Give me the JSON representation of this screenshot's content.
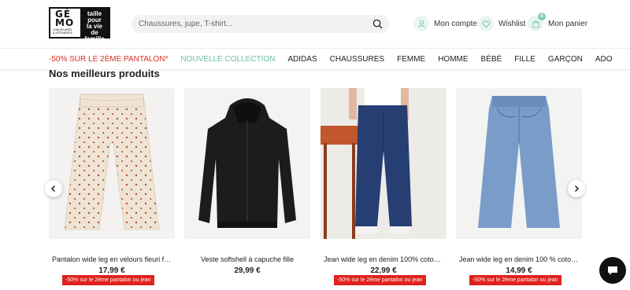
{
  "header": {
    "logo_letters": "GÉ\nMO",
    "logo_tagline": "taille\npour\nla vie\nde\nfamille",
    "logo_sub": "CHAUSSURES\n& VÊTEMENTS",
    "search_placeholder": "Chaussures, jupe, T-shirt...",
    "account_label": "Mon compte",
    "wishlist_label": "Wishlist",
    "cart_label": "Mon panier",
    "cart_count": "0"
  },
  "nav": [
    "-50% SUR LE 2ÈME PANTALON*",
    "NOUVELLE COLLECTION",
    "ADIDAS",
    "CHAUSSURES",
    "FEMME",
    "HOMME",
    "BÉBÉ",
    "FILLE",
    "GARÇON",
    "ADO"
  ],
  "section_title": "Nos meilleurs produits",
  "products": [
    {
      "name": "Pantalon wide leg en velours fleuri fill...",
      "price": "17,99 €",
      "badge": "-50% sur le 2ème pantalon ou jean"
    },
    {
      "name": "Veste softshell à capuche fille",
      "price": "29,99 €",
      "badge": ""
    },
    {
      "name": "Jean wide leg en denim 100% coton ...",
      "price": "22,99 €",
      "badge": "-50% sur le 2ème pantalon ou jean"
    },
    {
      "name": "Jean wide leg en denim 100 % coton ...",
      "price": "14,99 €",
      "badge": "-50% sur le 2ème pantalon ou jean"
    }
  ],
  "icons": [
    "search-icon",
    "user-icon",
    "heart-icon",
    "bag-icon",
    "chevron-left-icon",
    "chevron-right-icon",
    "chat-icon"
  ],
  "colors": {
    "promo_red": "#e0211d",
    "accent_green": "#6cc2a4"
  }
}
